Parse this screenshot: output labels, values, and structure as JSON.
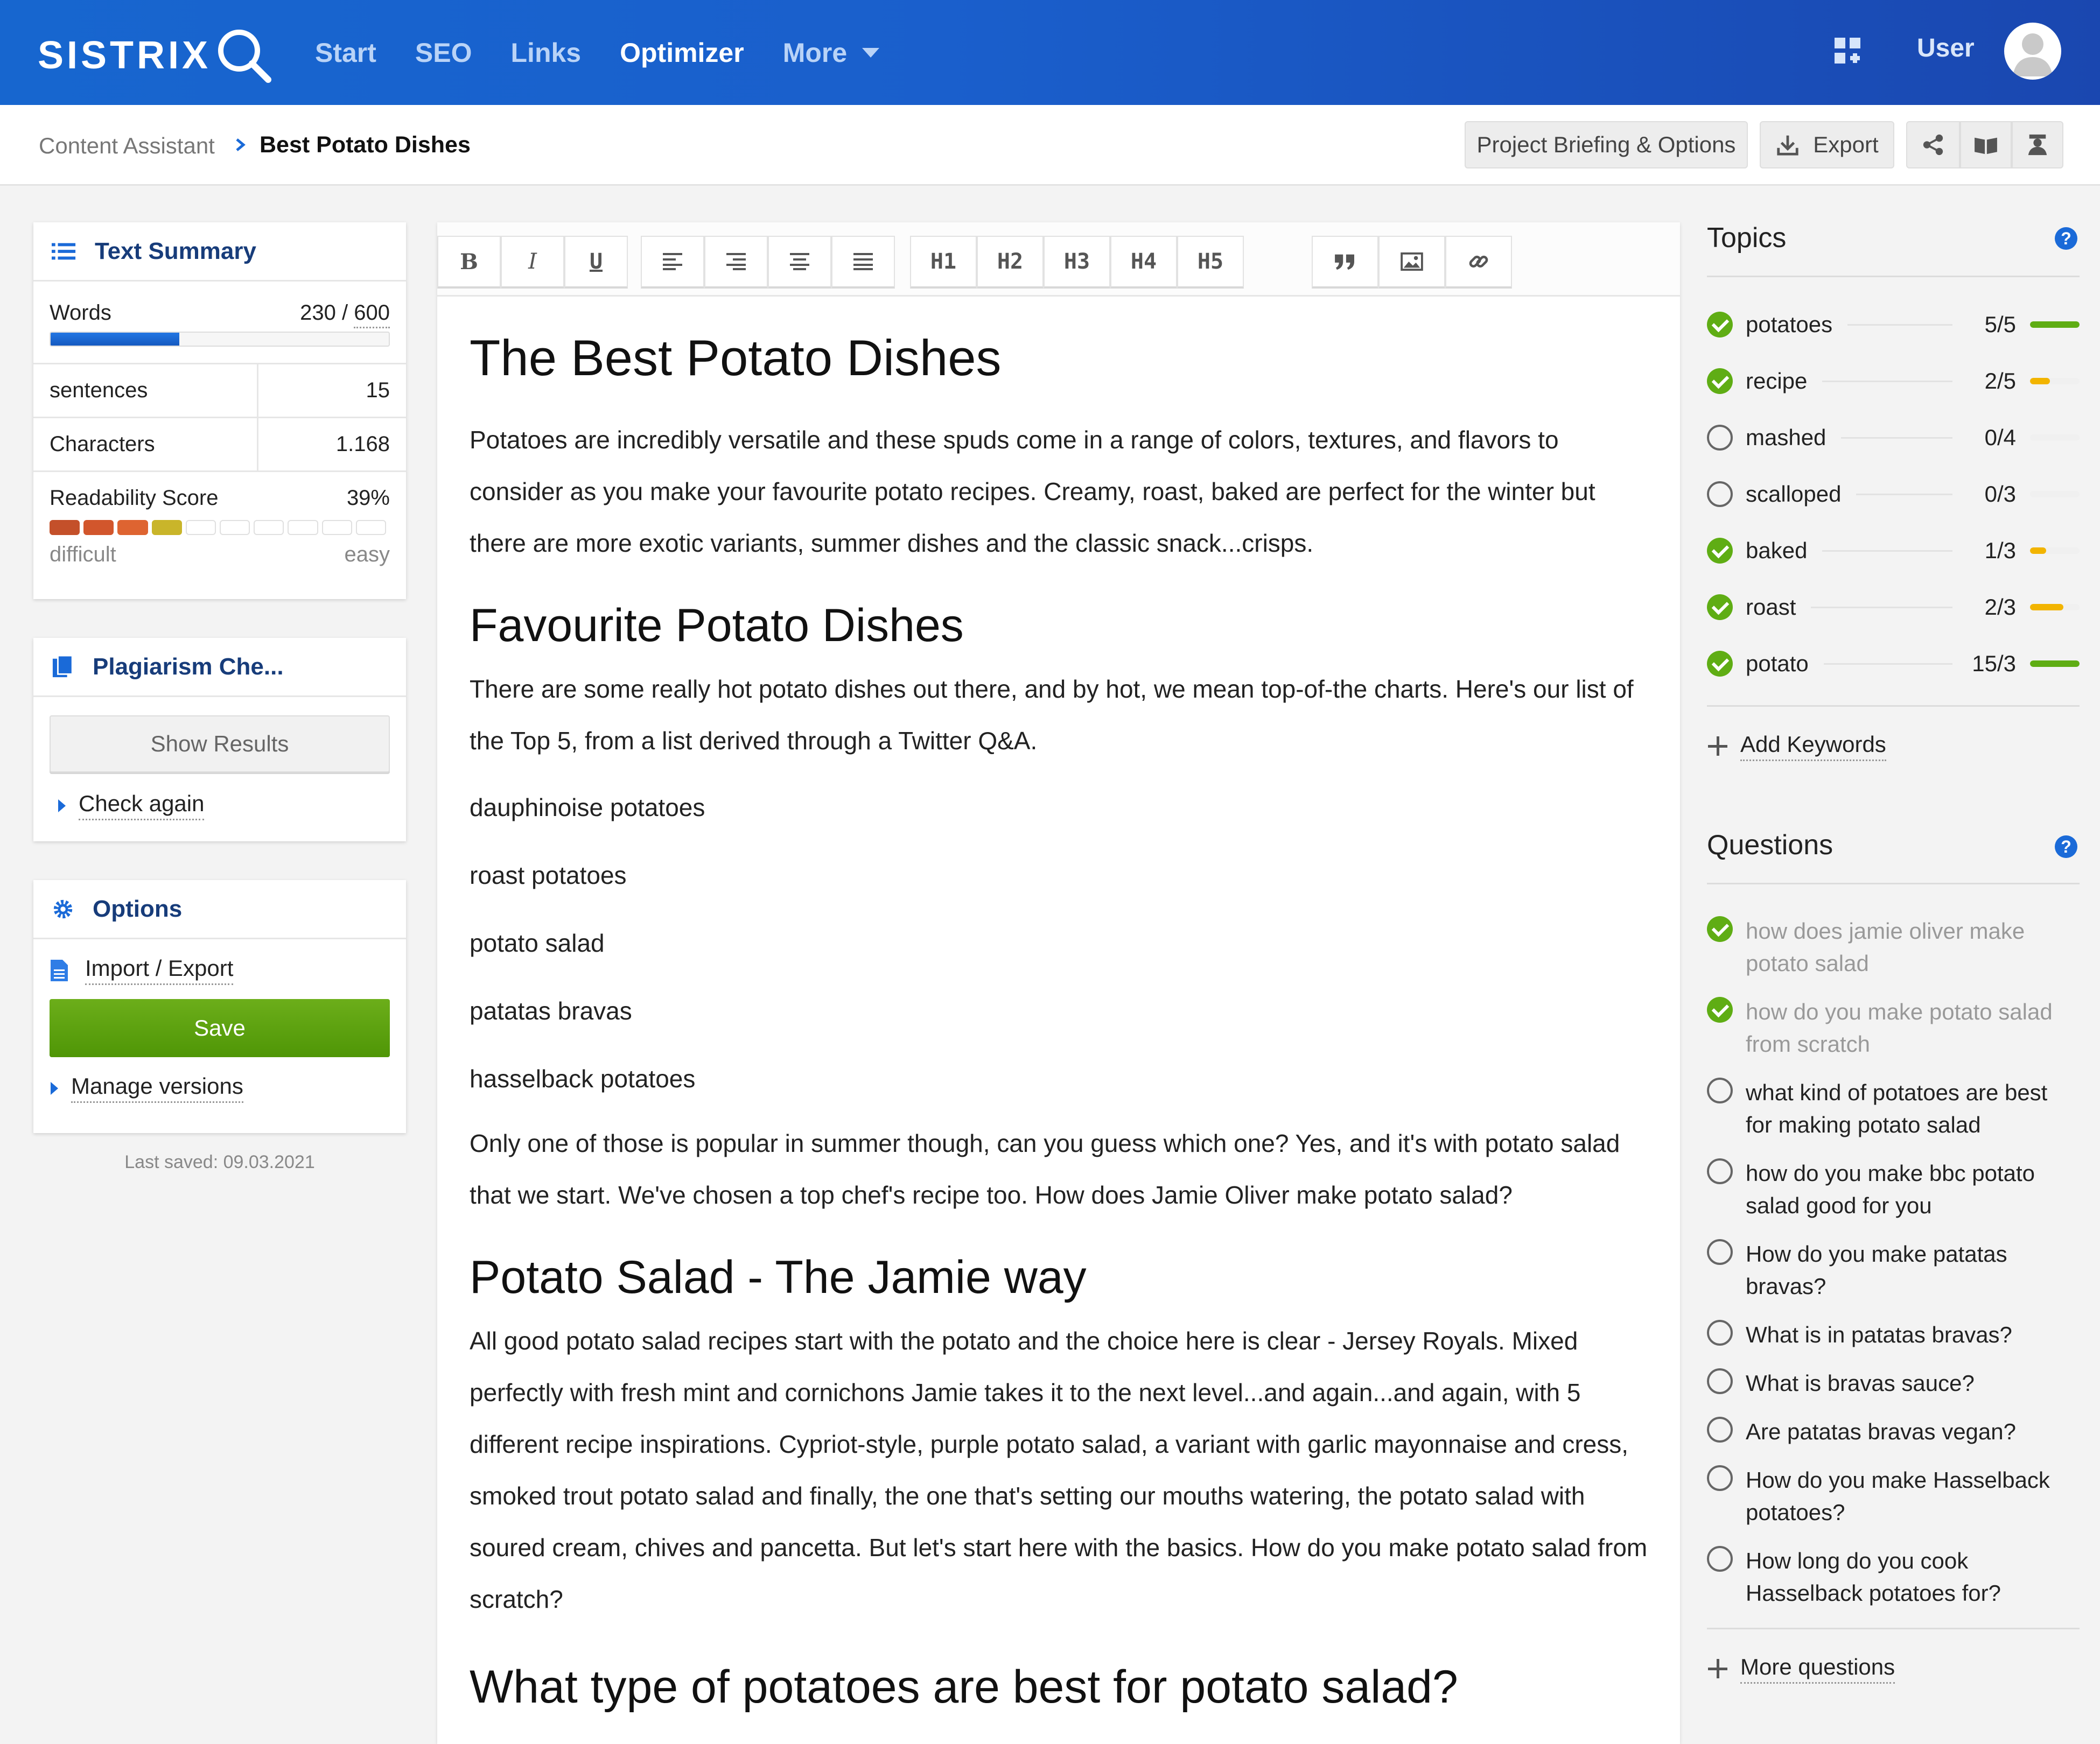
{
  "nav": {
    "logo": "SISTRIX",
    "items": [
      "Start",
      "SEO",
      "Links",
      "Optimizer",
      "More"
    ],
    "active": "Optimizer",
    "user_label": "User"
  },
  "breadcrumb": {
    "root": "Content Assistant",
    "current": "Best Potato Dishes"
  },
  "header_actions": {
    "briefing": "Project Briefing & Options",
    "export": "Export"
  },
  "text_summary": {
    "title": "Text Summary",
    "words_label": "Words",
    "words_value": "230",
    "words_sep": " / ",
    "words_target": "600",
    "words_progress": 0.38,
    "sentences_label": "sentences",
    "sentences_value": "15",
    "characters_label": "Characters",
    "characters_value": "1.168",
    "readability_label": "Readability Score",
    "readability_value": "39%",
    "readability_segments_filled": 4,
    "readability_segments_total": 10,
    "difficult_label": "difficult",
    "easy_label": "easy"
  },
  "plagiarism": {
    "title": "Plagiarism Che...",
    "show_results": "Show Results",
    "check_again": "Check again"
  },
  "options": {
    "title": "Options",
    "import_export": "Import / Export",
    "save": "Save",
    "manage_versions": "Manage versions",
    "last_saved": "Last saved: 09.03.2021"
  },
  "toolbar": [
    "B",
    "I",
    "U",
    "H1",
    "H2",
    "H3",
    "H4",
    "H5"
  ],
  "document": {
    "h1": "The Best Potato Dishes",
    "p1": "Potatoes are incredibly versatile and these spuds come in a range of colors, textures, and flavors to consider as you make your favourite potato recipes. Creamy, roast, baked are perfect for the winter but there are more exotic variants, summer dishes and the classic snack...crisps.",
    "h2a": "Favourite Potato Dishes",
    "p2": "There are some really hot potato dishes out there, and by hot, we mean top-of-the charts. Here's our list of the Top 5, from a list derived through a Twitter Q&A.",
    "list": [
      "dauphinoise potatoes",
      "roast potatoes",
      "potato salad",
      "patatas bravas",
      "hasselback potatoes"
    ],
    "p3": "Only one of those is popular in summer though, can you guess which one? Yes, and it's with potato salad that we start. We've chosen a top chef's recipe too. How does Jamie Oliver make potato salad?",
    "h2b": "Potato Salad - The Jamie way",
    "p4": "All good potato salad recipes start with the potato and the choice here is clear - Jersey Royals. Mixed perfectly with fresh mint and cornichons Jamie takes it to the next level...and again...and again, with 5 different recipe inspirations. Cypriot-style, purple potato salad, a variant with garlic mayonnaise and cress, smoked trout potato salad and finally, the one that's setting our mouths watering, the potato salad with soured cream, chives and pancetta. But let's start here with the basics. How do you make potato salad from scratch?",
    "h2c": "What type of potatoes are best for potato salad?"
  },
  "topics": {
    "title": "Topics",
    "help": "?",
    "items": [
      {
        "name": "potatoes",
        "count": "5/5",
        "done": true,
        "fill": 1.0,
        "color": "#5fad14"
      },
      {
        "name": "recipe",
        "count": "2/5",
        "done": true,
        "fill": 0.4,
        "color": "#f2b400"
      },
      {
        "name": "mashed",
        "count": "0/4",
        "done": false,
        "fill": 0.0,
        "color": "#f2b400"
      },
      {
        "name": "scalloped",
        "count": "0/3",
        "done": false,
        "fill": 0.0,
        "color": "#f2b400"
      },
      {
        "name": "baked",
        "count": "1/3",
        "done": true,
        "fill": 0.33,
        "color": "#f2b400"
      },
      {
        "name": "roast",
        "count": "2/3",
        "done": true,
        "fill": 0.67,
        "color": "#f2b400"
      },
      {
        "name": "potato",
        "count": "15/3",
        "done": true,
        "fill": 1.0,
        "color": "#5fad14"
      }
    ],
    "add_keywords": "Add Keywords"
  },
  "questions": {
    "title": "Questions",
    "help": "?",
    "items": [
      {
        "text": "how does jamie oliver make potato salad",
        "done": true
      },
      {
        "text": "how do you make potato salad from scratch",
        "done": true
      },
      {
        "text": "what kind of potatoes are best for making potato salad",
        "done": false
      },
      {
        "text": "how do you make bbc potato salad good for you",
        "done": false
      },
      {
        "text": "How do you make patatas bravas?",
        "done": false
      },
      {
        "text": "What is in patatas bravas?",
        "done": false
      },
      {
        "text": "What is bravas sauce?",
        "done": false
      },
      {
        "text": "Are patatas bravas vegan?",
        "done": false
      },
      {
        "text": "How do you make Hasselback potatoes?",
        "done": false
      },
      {
        "text": "How long do you cook Hasselback potatoes for?",
        "done": false
      }
    ],
    "more": "More questions"
  }
}
